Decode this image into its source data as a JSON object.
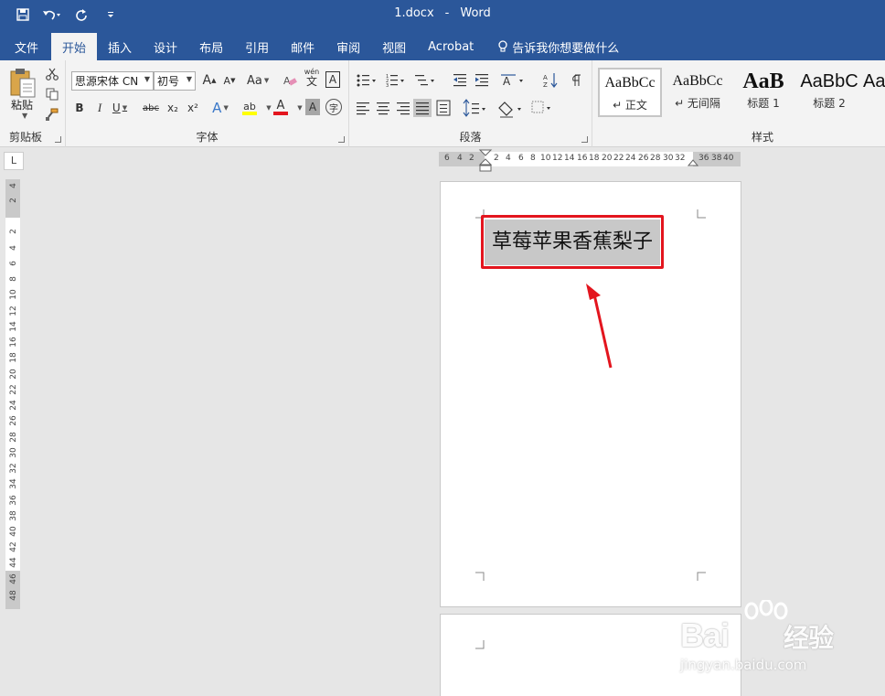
{
  "window": {
    "title_file": "1.docx",
    "title_sep": "-",
    "title_app": "Word"
  },
  "tabs": [
    {
      "label": "文件"
    },
    {
      "label": "开始"
    },
    {
      "label": "插入"
    },
    {
      "label": "设计"
    },
    {
      "label": "布局"
    },
    {
      "label": "引用"
    },
    {
      "label": "邮件"
    },
    {
      "label": "审阅"
    },
    {
      "label": "视图"
    },
    {
      "label": "Acrobat"
    }
  ],
  "tell_me": "告诉我你想要做什么",
  "clipboard": {
    "paste_label": "粘贴",
    "group_label": "剪贴板"
  },
  "font": {
    "font_name": "思源宋体 CN",
    "font_size": "初号",
    "group_label": "字体",
    "grow": "A",
    "shrink": "A",
    "change_case": "Aa",
    "phonetic": "wén",
    "phonetic_char": "文",
    "char_border": "A",
    "bold": "B",
    "italic": "I",
    "underline": "U",
    "strike": "abc",
    "subscript": "x₂",
    "superscript": "x²",
    "effects": "A",
    "highlight": "ab",
    "font_color": "A",
    "shading": "A",
    "enclose": "字"
  },
  "paragraph": {
    "group_label": "段落"
  },
  "styles": {
    "group_label": "样式",
    "items": [
      {
        "preview": "AaBbCc",
        "name": "↵ 正文"
      },
      {
        "preview": "AaBbCc",
        "name": "↵ 无间隔"
      },
      {
        "preview": "AaB",
        "name": "标题 1"
      },
      {
        "preview": "AaBbC",
        "name": "标题 2"
      },
      {
        "preview": "Aa",
        "name": ""
      }
    ]
  },
  "ruler": {
    "corner": "L",
    "h_labels": [
      "6",
      "4",
      "2",
      "2",
      "4",
      "6",
      "8",
      "10",
      "12",
      "14",
      "16",
      "18",
      "20",
      "22",
      "24",
      "26",
      "28",
      "30",
      "32",
      "36",
      "38",
      "40"
    ],
    "v_labels": [
      "4",
      "2",
      "2",
      "4",
      "6",
      "8",
      "10",
      "12",
      "14",
      "16",
      "18",
      "20",
      "22",
      "24",
      "26",
      "28",
      "30",
      "32",
      "34",
      "36",
      "38",
      "40",
      "42",
      "44",
      "46",
      "48"
    ]
  },
  "document": {
    "selected_text": "草莓苹果香蕉梨子"
  },
  "watermark": {
    "brand": "Bai",
    "brand_tail": "经验",
    "url": "jingyan.baidu.com"
  },
  "colors": {
    "brand_blue": "#2b579a",
    "highlight_red": "#e3151e",
    "selection_gray": "#c8c8c8"
  }
}
